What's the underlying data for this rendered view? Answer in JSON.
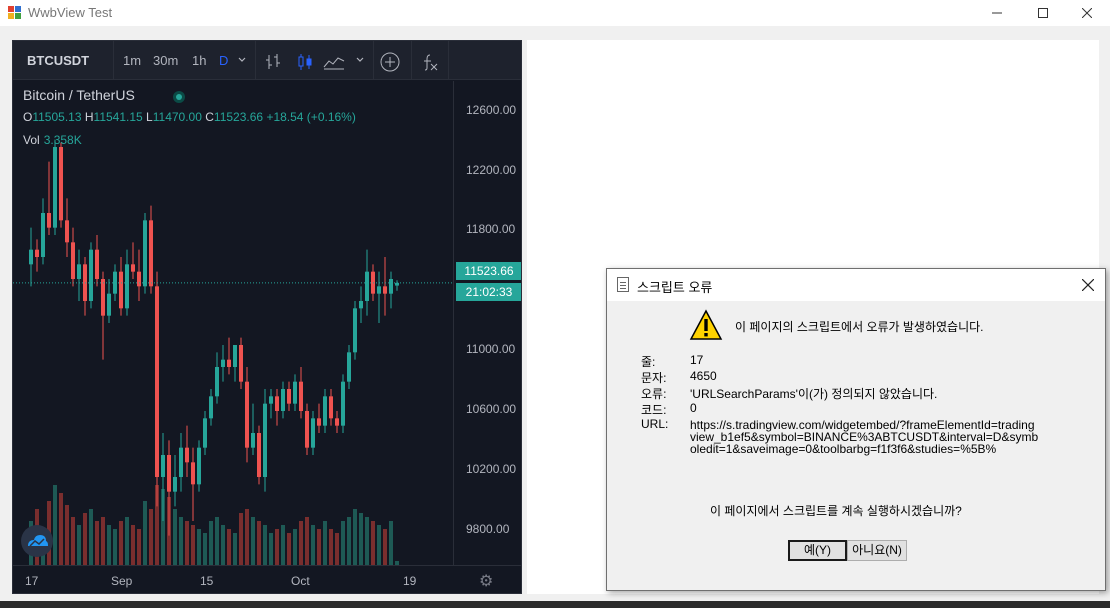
{
  "window": {
    "title": "WwbView Test",
    "minimize_icon": "minimize-icon",
    "maximize_icon": "maximize-icon",
    "close_icon": "close-icon"
  },
  "toolbar": {
    "symbol": "BTCUSDT",
    "intervals": [
      "1m",
      "30m",
      "1h",
      "D"
    ],
    "active_interval": "D",
    "icons": [
      "bar-style-icon",
      "candle-style-icon",
      "area-style-icon",
      "chevron-down-icon",
      "compare-plus-icon",
      "indicators-fx-icon"
    ]
  },
  "legend": {
    "title": "Bitcoin / TetherUS",
    "o_label": "O",
    "o_value": "11505.13",
    "h_label": "H",
    "h_value": "11541.15",
    "l_label": "L",
    "l_value": "11470.00",
    "c_label": "C",
    "c_value": "11523.66",
    "change": "+18.54 (+0.16%)",
    "vol_label": "Vol",
    "vol_value": "3.358K"
  },
  "price_axis": {
    "ticks": [
      "12600.00",
      "12200.00",
      "11800.00",
      "11000.00",
      "10600.00",
      "10200.00",
      "9800.00"
    ],
    "last_price": "11523.66",
    "countdown": "21:02:33"
  },
  "time_axis": {
    "ticks": [
      "17",
      "Sep",
      "15",
      "Oct",
      "19"
    ]
  },
  "colors": {
    "up": "#26a69a",
    "down": "#ef5350",
    "background": "#131722",
    "accent": "#2962ff"
  },
  "chart_data": {
    "type": "candlestick",
    "symbol": "BTCUSDT",
    "interval": "D",
    "ylim": [
      9600,
      12900
    ],
    "candles": [
      {
        "o": 11650,
        "h": 11900,
        "l": 11500,
        "c": 11750
      },
      {
        "o": 11750,
        "h": 11820,
        "l": 11600,
        "c": 11700
      },
      {
        "o": 11700,
        "h": 12100,
        "l": 11650,
        "c": 12000
      },
      {
        "o": 12000,
        "h": 12350,
        "l": 11850,
        "c": 11900
      },
      {
        "o": 11900,
        "h": 12500,
        "l": 11850,
        "c": 12450
      },
      {
        "o": 12450,
        "h": 12480,
        "l": 11900,
        "c": 11950
      },
      {
        "o": 11950,
        "h": 12100,
        "l": 11700,
        "c": 11800
      },
      {
        "o": 11800,
        "h": 11900,
        "l": 11500,
        "c": 11550
      },
      {
        "o": 11550,
        "h": 11750,
        "l": 11400,
        "c": 11650
      },
      {
        "o": 11650,
        "h": 11700,
        "l": 11300,
        "c": 11400
      },
      {
        "o": 11400,
        "h": 11800,
        "l": 11350,
        "c": 11750
      },
      {
        "o": 11750,
        "h": 11850,
        "l": 11500,
        "c": 11550
      },
      {
        "o": 11550,
        "h": 11600,
        "l": 11000,
        "c": 11300
      },
      {
        "o": 11300,
        "h": 11550,
        "l": 11250,
        "c": 11450
      },
      {
        "o": 11450,
        "h": 11650,
        "l": 11400,
        "c": 11600
      },
      {
        "o": 11600,
        "h": 11700,
        "l": 11300,
        "c": 11350
      },
      {
        "o": 11350,
        "h": 11750,
        "l": 11300,
        "c": 11650
      },
      {
        "o": 11650,
        "h": 11800,
        "l": 11550,
        "c": 11600
      },
      {
        "o": 11600,
        "h": 11750,
        "l": 11400,
        "c": 11500
      },
      {
        "o": 11500,
        "h": 12000,
        "l": 11450,
        "c": 11950
      },
      {
        "o": 11950,
        "h": 12050,
        "l": 11450,
        "c": 11500
      },
      {
        "o": 11500,
        "h": 11600,
        "l": 10000,
        "c": 10200
      },
      {
        "o": 10200,
        "h": 10500,
        "l": 9900,
        "c": 10350
      },
      {
        "o": 10350,
        "h": 10450,
        "l": 9800,
        "c": 10100
      },
      {
        "o": 10100,
        "h": 10350,
        "l": 10000,
        "c": 10200
      },
      {
        "o": 10200,
        "h": 10500,
        "l": 10100,
        "c": 10400
      },
      {
        "o": 10400,
        "h": 10550,
        "l": 10200,
        "c": 10300
      },
      {
        "o": 10300,
        "h": 10400,
        "l": 9900,
        "c": 10150
      },
      {
        "o": 10150,
        "h": 10450,
        "l": 10100,
        "c": 10400
      },
      {
        "o": 10400,
        "h": 10650,
        "l": 10350,
        "c": 10600
      },
      {
        "o": 10600,
        "h": 10800,
        "l": 10550,
        "c": 10750
      },
      {
        "o": 10750,
        "h": 11050,
        "l": 10700,
        "c": 10950
      },
      {
        "o": 10950,
        "h": 11100,
        "l": 10850,
        "c": 11000
      },
      {
        "o": 11000,
        "h": 11150,
        "l": 10900,
        "c": 10950
      },
      {
        "o": 10950,
        "h": 11100,
        "l": 10850,
        "c": 11100
      },
      {
        "o": 11100,
        "h": 11150,
        "l": 10800,
        "c": 10850
      },
      {
        "o": 10850,
        "h": 10950,
        "l": 10300,
        "c": 10400
      },
      {
        "o": 10400,
        "h": 10700,
        "l": 10350,
        "c": 10500
      },
      {
        "o": 10500,
        "h": 10550,
        "l": 10150,
        "c": 10200
      },
      {
        "o": 10200,
        "h": 10800,
        "l": 10100,
        "c": 10700
      },
      {
        "o": 10700,
        "h": 10800,
        "l": 10600,
        "c": 10750
      },
      {
        "o": 10750,
        "h": 10800,
        "l": 10550,
        "c": 10650
      },
      {
        "o": 10650,
        "h": 10850,
        "l": 10600,
        "c": 10800
      },
      {
        "o": 10800,
        "h": 10850,
        "l": 10650,
        "c": 10700
      },
      {
        "o": 10700,
        "h": 10900,
        "l": 10650,
        "c": 10850
      },
      {
        "o": 10850,
        "h": 10950,
        "l": 10600,
        "c": 10650
      },
      {
        "o": 10650,
        "h": 10700,
        "l": 10350,
        "c": 10400
      },
      {
        "o": 10400,
        "h": 10650,
        "l": 10350,
        "c": 10600
      },
      {
        "o": 10600,
        "h": 10700,
        "l": 10500,
        "c": 10550
      },
      {
        "o": 10550,
        "h": 10800,
        "l": 10500,
        "c": 10750
      },
      {
        "o": 10750,
        "h": 10800,
        "l": 10550,
        "c": 10600
      },
      {
        "o": 10600,
        "h": 10650,
        "l": 10500,
        "c": 10550
      },
      {
        "o": 10550,
        "h": 10900,
        "l": 10500,
        "c": 10850
      },
      {
        "o": 10850,
        "h": 11100,
        "l": 10800,
        "c": 11050
      },
      {
        "o": 11050,
        "h": 11400,
        "l": 11000,
        "c": 11350
      },
      {
        "o": 11350,
        "h": 11500,
        "l": 11250,
        "c": 11400
      },
      {
        "o": 11400,
        "h": 11750,
        "l": 11300,
        "c": 11600
      },
      {
        "o": 11600,
        "h": 11650,
        "l": 11400,
        "c": 11450
      },
      {
        "o": 11450,
        "h": 11600,
        "l": 11250,
        "c": 11500
      },
      {
        "o": 11500,
        "h": 11700,
        "l": 11300,
        "c": 11450
      },
      {
        "o": 11450,
        "h": 11600,
        "l": 11350,
        "c": 11550
      },
      {
        "o": 11505.13,
        "h": 11541.15,
        "l": 11470.0,
        "c": 11523.66
      }
    ],
    "volumes": [
      55,
      70,
      45,
      80,
      100,
      90,
      75,
      60,
      50,
      65,
      70,
      55,
      60,
      50,
      45,
      55,
      60,
      50,
      45,
      80,
      70,
      100,
      95,
      85,
      70,
      60,
      55,
      50,
      45,
      40,
      55,
      60,
      50,
      45,
      40,
      65,
      70,
      60,
      55,
      50,
      40,
      45,
      50,
      40,
      45,
      55,
      60,
      50,
      45,
      55,
      45,
      40,
      55,
      60,
      70,
      65,
      60,
      55,
      50,
      45,
      55,
      5
    ]
  },
  "dialog": {
    "title": "스크립트 오류",
    "message": "이 페이지의 스크립트에서 오류가 발생하였습니다.",
    "line_label": "줄:",
    "line_value": "17",
    "char_label": "문자:",
    "char_value": "4650",
    "error_label": "오류:",
    "error_value": "'URLSearchParams'이(가) 정의되지 않았습니다.",
    "code_label": "코드:",
    "code_value": "0",
    "url_label": "URL:",
    "url_value": "https://s.tradingview.com/widgetembed/?frameElementId=tradingview_b1ef5&symbol=BINANCE%3ABTCUSDT&interval=D&symboledit=1&saveimage=0&toolbarbg=f1f3f6&studies=%5B%",
    "question": "이 페이지에서 스크립트를 계속 실행하시겠습니까?",
    "yes_label": "예(Y)",
    "no_label": "아니요(N)"
  }
}
